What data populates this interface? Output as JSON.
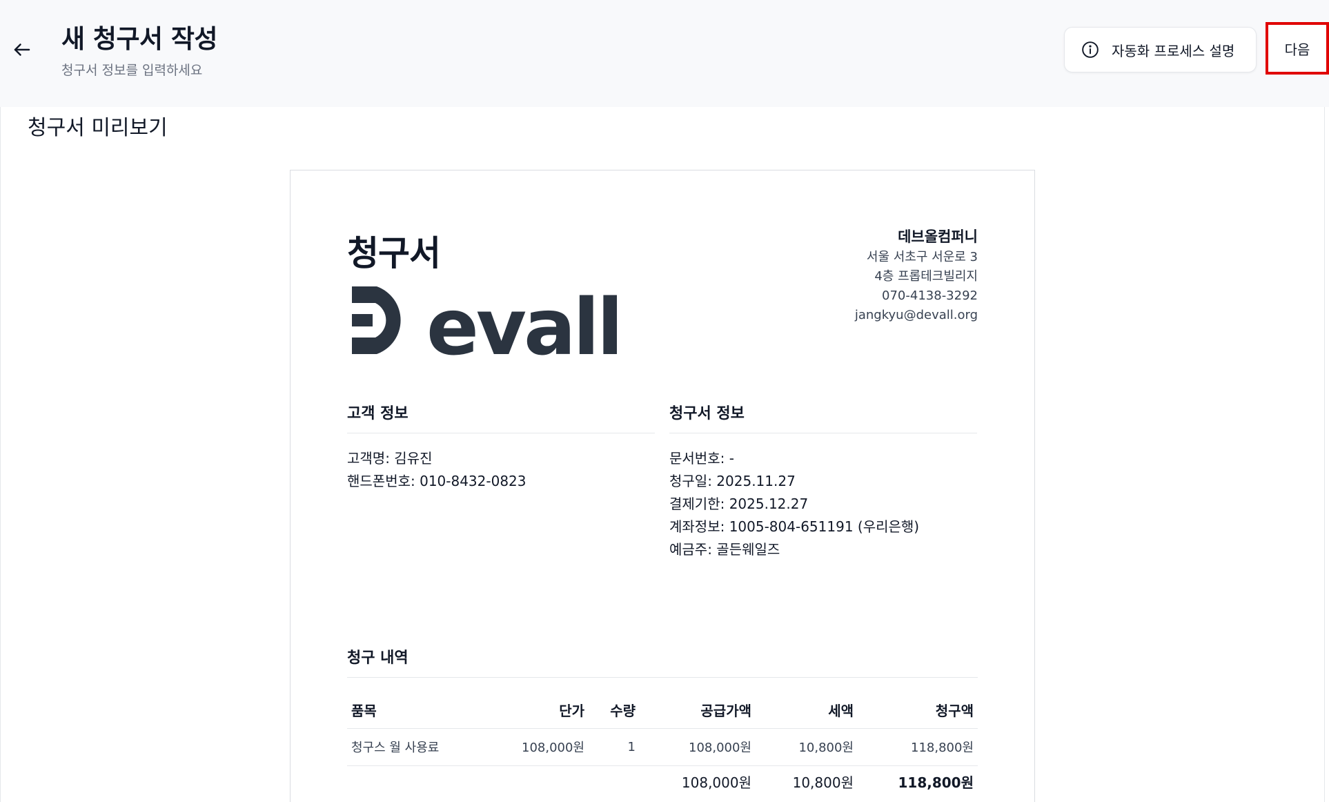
{
  "header": {
    "title": "새 청구서 작성",
    "subtitle": "청구서 정보를 입력하세요",
    "info_button": "자동화 프로세스 설명",
    "next_button": "다음"
  },
  "preview": {
    "title": "청구서 미리보기"
  },
  "invoice": {
    "heading": "청구서",
    "logo_text": "Devall",
    "company": {
      "name": "데브올컴퍼니",
      "address1": "서울 서초구 서운로 3",
      "address2": "4층 프롭테크빌리지",
      "phone": "070-4138-3292",
      "email": "jangkyu@devall.org"
    },
    "customer": {
      "title": "고객 정보",
      "name": "고객명: 김유진",
      "phone": "핸드폰번호: 010-8432-0823"
    },
    "info": {
      "title": "청구서 정보",
      "doc_no": "문서번호: -",
      "date": "청구일: 2025.11.27",
      "due": "결제기한: 2025.12.27",
      "account": "계좌정보: 1005-804-651191 (우리은행)",
      "holder": "예금주: 골든웨일즈"
    },
    "items": {
      "title": "청구 내역",
      "headers": [
        "품목",
        "단가",
        "수량",
        "공급가액",
        "세액",
        "청구액"
      ],
      "rows": [
        [
          "청구스 월 사용료",
          "108,000원",
          "1",
          "108,000원",
          "10,800원",
          "118,800원"
        ]
      ],
      "totals": {
        "supply": "108,000원",
        "tax": "10,800원",
        "grand": "118,800원"
      }
    }
  },
  "colors": {
    "highlight": "#e00000",
    "text": "#111827",
    "muted": "#6b7280",
    "logo": "#2b3440"
  },
  "icons": [
    "arrow-left-icon",
    "info-circle-icon"
  ]
}
